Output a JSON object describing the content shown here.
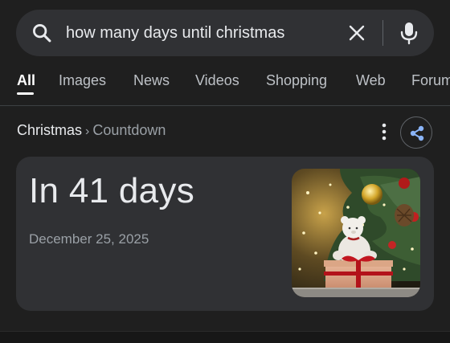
{
  "search": {
    "query": "how many days until christmas",
    "search_icon": "search-icon",
    "clear_icon": "close-icon",
    "mic_icon": "microphone-icon"
  },
  "tabs": [
    {
      "label": "All",
      "active": true
    },
    {
      "label": "Images",
      "active": false
    },
    {
      "label": "News",
      "active": false
    },
    {
      "label": "Videos",
      "active": false
    },
    {
      "label": "Shopping",
      "active": false
    },
    {
      "label": "Web",
      "active": false
    },
    {
      "label": "Forum",
      "active": false
    }
  ],
  "breadcrumb": {
    "main": "Christmas",
    "separator": "›",
    "sub": "Countdown",
    "more_icon": "more-vert-icon",
    "share_icon": "share-icon"
  },
  "countdown": {
    "headline": "In 41 days",
    "date": "December 25, 2025",
    "image": "christmas-tree-teddy-bear-gift-photo"
  },
  "colors": {
    "background": "#1f1f1f",
    "surface": "#303134",
    "text_primary": "#e8eaed",
    "text_secondary": "#9aa0a6",
    "accent": "#8ab4f8"
  }
}
